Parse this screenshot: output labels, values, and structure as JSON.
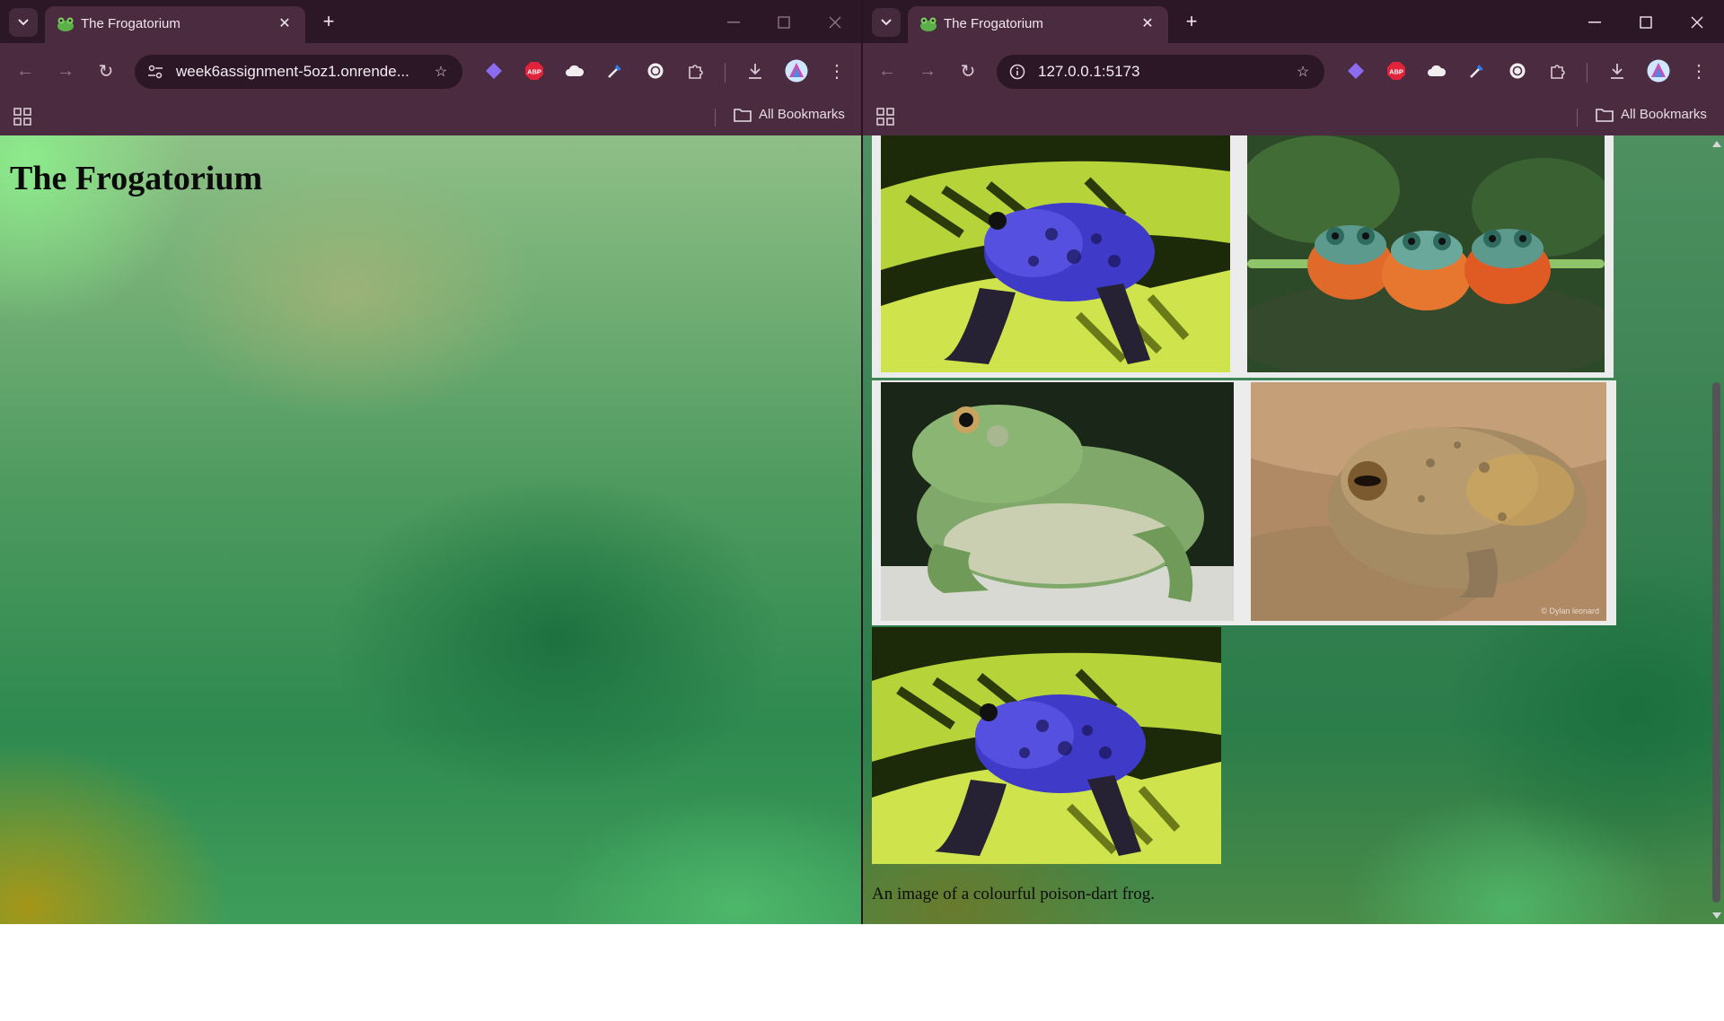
{
  "left_window": {
    "tab": {
      "title": "The Frogatorium"
    },
    "address_bar": {
      "url": "week6assignment-5oz1.onrende..."
    },
    "bookmarks_bar": {
      "all_bookmarks": "All Bookmarks"
    },
    "page": {
      "heading": "The Frogatorium"
    }
  },
  "right_window": {
    "tab": {
      "title": "The Frogatorium"
    },
    "address_bar": {
      "url": "127.0.0.1:5173"
    },
    "bookmarks_bar": {
      "all_bookmarks": "All Bookmarks"
    },
    "page": {
      "gallery": [
        {
          "subject": "blue poison-dart frog"
        },
        {
          "subject": "three flying frogs on a branch"
        },
        {
          "subject": "green tree frog"
        },
        {
          "subject": "desert rain frog",
          "watermark": "© Dylan leonard"
        },
        {
          "subject": "blue poison-dart frog"
        }
      ],
      "caption": "An image of a colourful poison-dart frog."
    }
  },
  "extensions": [
    "diamond-icon",
    "adblock-icon",
    "cloud-icon",
    "eyedropper-icon",
    "circle-icon",
    "puzzle-icon"
  ],
  "extension_labels": {
    "adblock": "ABP"
  },
  "colors": {
    "tab_strip": "#2b1725",
    "toolbar": "#4a2b3f",
    "omnibox": "#2b1725"
  }
}
